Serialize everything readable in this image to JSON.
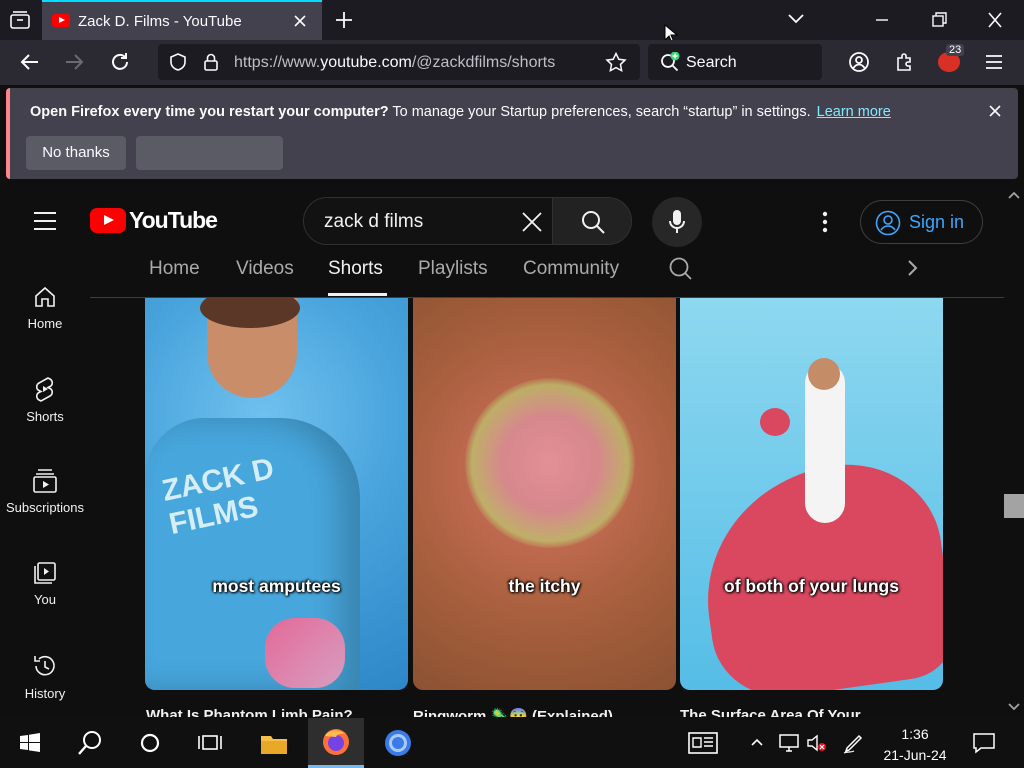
{
  "browser": {
    "tab_title": "Zack D. Films - YouTube",
    "url_prefix": "https://www.",
    "url_domain": "youtube.com",
    "url_path": "/@zackdfilms/shorts",
    "search_placeholder": "Search",
    "extension_badge": "23"
  },
  "notification": {
    "bold_text": "Open Firefox every time you restart your computer?",
    "text": " To manage your Startup preferences, search “startup” in settings.",
    "link": "Learn more",
    "no_thanks": "No thanks",
    "second_button": ""
  },
  "youtube": {
    "logo_text": "YouTube",
    "search_query": "zack d films",
    "sign_in": "Sign in",
    "tabs": [
      "Home",
      "Videos",
      "Shorts",
      "Playlists",
      "Community"
    ],
    "active_tab": "Shorts",
    "sidebar": [
      "Home",
      "Shorts",
      "Subscriptions",
      "You",
      "History"
    ],
    "shorts": [
      {
        "caption": "most amputees",
        "title": "What Is Phantom Limb Pain?"
      },
      {
        "caption": "the itchy",
        "title": "Ringworm 🦠😨 (Explained)"
      },
      {
        "caption": "of both of your lungs",
        "title": "The Surface Area Of Your"
      }
    ]
  },
  "taskbar": {
    "time": "1:36",
    "date": "21-Jun-24"
  },
  "colors": {
    "accent_tab": "#00ddff",
    "youtube_red": "#ff0000",
    "link_blue": "#3ea6ff",
    "notif_bar": "#ff848b"
  }
}
